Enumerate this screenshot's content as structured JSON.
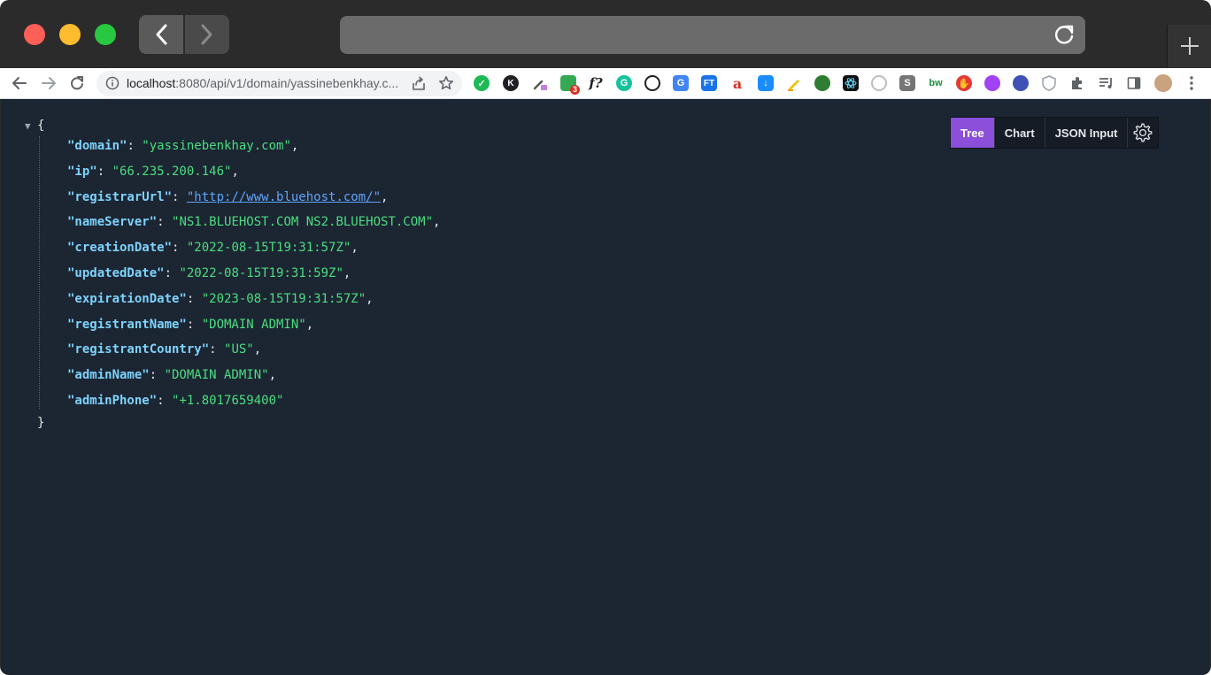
{
  "browser": {
    "url_host": "localhost",
    "url_rest": ":8080/api/v1/domain/yassinebenkhay.c...",
    "colors": {
      "titlebar": "#2b2b2b",
      "content_bg": "#1c2532",
      "accent": "#8b4fd9"
    },
    "extension_icons": [
      "shield-ext-icon",
      "k-ext-icon",
      "eyedropper-ext-icon",
      "calendar-ext-icon",
      "function-ext-icon",
      "grammarly-ext-icon",
      "skull-ext-icon",
      "translate-ext-icon",
      "ft-ext-icon",
      "font-ext-icon",
      "download-ext-icon",
      "highlighter-ext-icon",
      "globe-ext-icon",
      "react-ext-icon",
      "circle-ext-icon",
      "notion-ext-icon",
      "bw-ext-icon",
      "adblock-ext-icon",
      "face-ext-icon",
      "planet-ext-icon",
      "shield2-ext-icon",
      "puzzle-ext-icon",
      "media-ext-icon",
      "sidepanel-ext-icon",
      "profile-avatar",
      "menu-icon"
    ]
  },
  "badges": {
    "calendar_count": "3"
  },
  "viewer": {
    "tabs": [
      {
        "label": "Tree",
        "active": true
      },
      {
        "label": "Chart",
        "active": false
      },
      {
        "label": "JSON Input",
        "active": false
      }
    ]
  },
  "json": {
    "open_brace": "{",
    "close_brace": "}",
    "entries": [
      {
        "key": "\"domain\"",
        "value": "\"yassinebenkhay.com\"",
        "comma": ","
      },
      {
        "key": "\"ip\"",
        "value": "\"66.235.200.146\"",
        "comma": ","
      },
      {
        "key": "\"registrarUrl\"",
        "value": "\"http://www.bluehost.com/\"",
        "comma": ",",
        "is_link": true
      },
      {
        "key": "\"nameServer\"",
        "value": "\"NS1.BLUEHOST.COM NS2.BLUEHOST.COM\"",
        "comma": ","
      },
      {
        "key": "\"creationDate\"",
        "value": "\"2022-08-15T19:31:57Z\"",
        "comma": ","
      },
      {
        "key": "\"updatedDate\"",
        "value": "\"2022-08-15T19:31:59Z\"",
        "comma": ","
      },
      {
        "key": "\"expirationDate\"",
        "value": "\"2023-08-15T19:31:57Z\"",
        "comma": ","
      },
      {
        "key": "\"registrantName\"",
        "value": "\"DOMAIN ADMIN\"",
        "comma": ","
      },
      {
        "key": "\"registrantCountry\"",
        "value": "\"US\"",
        "comma": ","
      },
      {
        "key": "\"adminName\"",
        "value": "\"DOMAIN ADMIN\"",
        "comma": ","
      },
      {
        "key": "\"adminPhone\"",
        "value": "\"+1.8017659400\"",
        "comma": ""
      }
    ]
  }
}
